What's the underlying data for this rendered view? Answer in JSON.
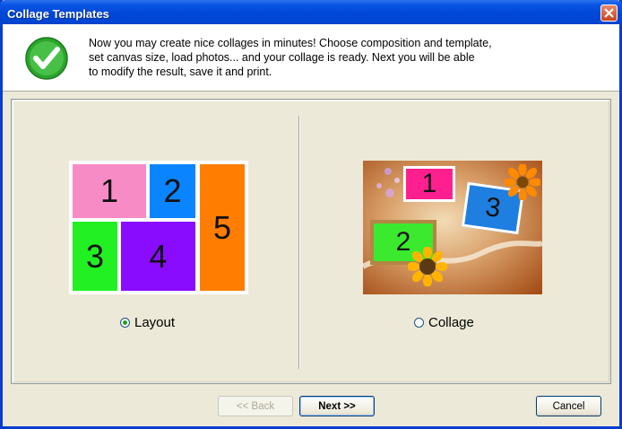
{
  "window": {
    "title": "Collage Templates"
  },
  "header": {
    "line1": "Now you may create nice collages in minutes! Choose composition and template,",
    "line2": "set canvas size, load photos... and your collage is ready. Next you will be able",
    "line3": "to modify the result, save it and print."
  },
  "layout_option": {
    "label": "Layout",
    "selected": true,
    "cells": [
      "1",
      "2",
      "3",
      "4",
      "5"
    ]
  },
  "collage_option": {
    "label": "Collage",
    "selected": false,
    "frames": [
      "1",
      "2",
      "3"
    ]
  },
  "buttons": {
    "back": "<< Back",
    "next": "Next >>",
    "cancel": "Cancel"
  },
  "colors": {
    "titlebar": "#0047d6",
    "cell1": "#f78bc6",
    "cell2": "#0a84ff",
    "cell3": "#22f022",
    "cell4": "#8a0cff",
    "cell5": "#ff7d00"
  }
}
